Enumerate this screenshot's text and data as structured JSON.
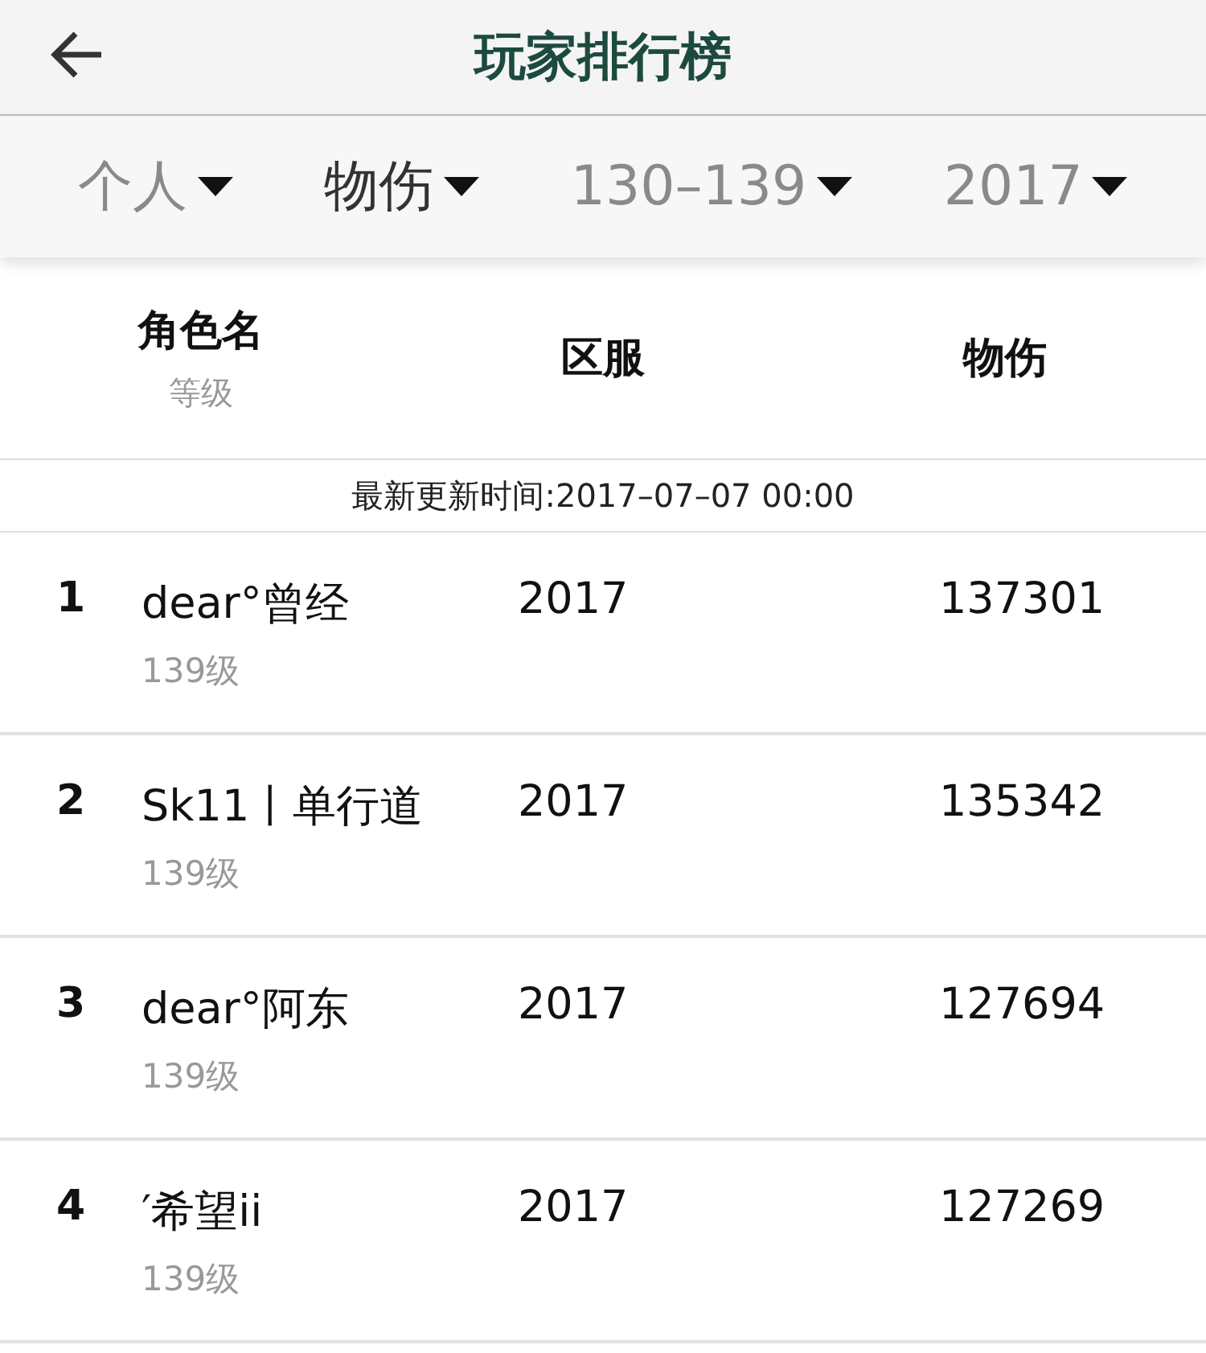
{
  "header": {
    "title": "玩家排行榜"
  },
  "filters": [
    {
      "label": "个人",
      "selected": false
    },
    {
      "label": "物伤",
      "selected": true
    },
    {
      "label": "130–139",
      "selected": false
    },
    {
      "label": "2017",
      "selected": false
    }
  ],
  "columns": {
    "name": "角色名",
    "level": "等级",
    "server": "区服",
    "score": "物伤"
  },
  "update_time": "最新更新时间:2017–07–07 00:00",
  "rows": [
    {
      "rank": "1",
      "name": "dear°曾经",
      "level": "139级",
      "server": "2017",
      "score": "137301"
    },
    {
      "rank": "2",
      "name": "Sk11丨单行道",
      "level": "139级",
      "server": "2017",
      "score": "135342"
    },
    {
      "rank": "3",
      "name": "dear°阿东",
      "level": "139级",
      "server": "2017",
      "score": "127694"
    },
    {
      "rank": "4",
      "name": "′希望ii",
      "level": "139级",
      "server": "2017",
      "score": "127269"
    }
  ]
}
